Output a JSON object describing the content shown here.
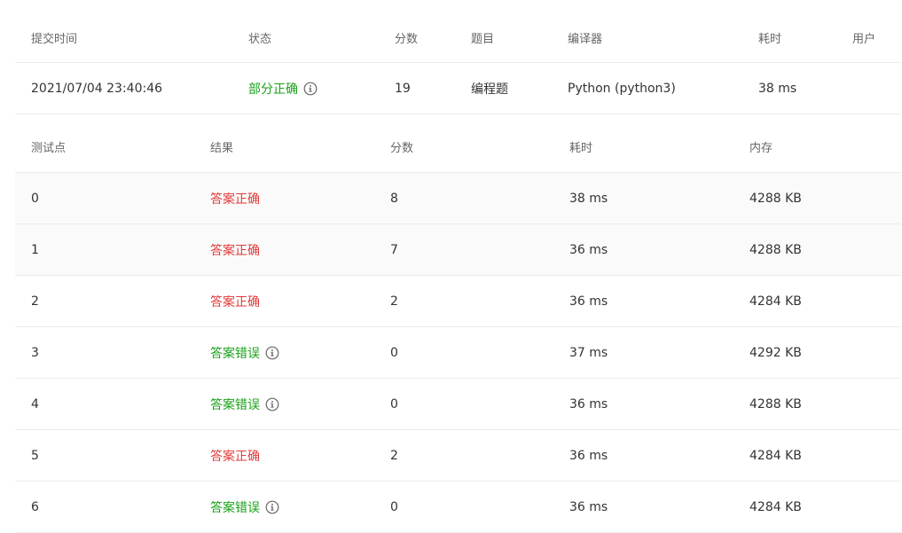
{
  "submission": {
    "headers": {
      "time": "提交时间",
      "status": "状态",
      "score": "分数",
      "problem": "题目",
      "compiler": "编译器",
      "elapsed": "耗时",
      "user": "用户"
    },
    "row": {
      "time": "2021/07/04 23:40:46",
      "status": "部分正确",
      "score": "19",
      "problem": "编程题",
      "compiler": "Python (python3)",
      "elapsed": "38 ms",
      "user": ""
    }
  },
  "testcases": {
    "headers": {
      "case": "测试点",
      "result": "结果",
      "score": "分数",
      "elapsed": "耗时",
      "memory": "内存"
    },
    "rows": [
      {
        "case": "0",
        "result": "答案正确",
        "score": "8",
        "elapsed": "38 ms",
        "memory": "4288 KB"
      },
      {
        "case": "1",
        "result": "答案正确",
        "score": "7",
        "elapsed": "36 ms",
        "memory": "4288 KB"
      },
      {
        "case": "2",
        "result": "答案正确",
        "score": "2",
        "elapsed": "36 ms",
        "memory": "4284 KB"
      },
      {
        "case": "3",
        "result": "答案错误",
        "score": "0",
        "elapsed": "37 ms",
        "memory": "4292 KB"
      },
      {
        "case": "4",
        "result": "答案错误",
        "score": "0",
        "elapsed": "36 ms",
        "memory": "4288 KB"
      },
      {
        "case": "5",
        "result": "答案正确",
        "score": "2",
        "elapsed": "36 ms",
        "memory": "4284 KB"
      },
      {
        "case": "6",
        "result": "答案错误",
        "score": "0",
        "elapsed": "36 ms",
        "memory": "4284 KB"
      }
    ]
  },
  "colors": {
    "accepted": "#e03a3a",
    "wrong": "#1aa01a",
    "partial": "#1aa01a"
  },
  "icons": {
    "info": "info-circle-icon"
  }
}
